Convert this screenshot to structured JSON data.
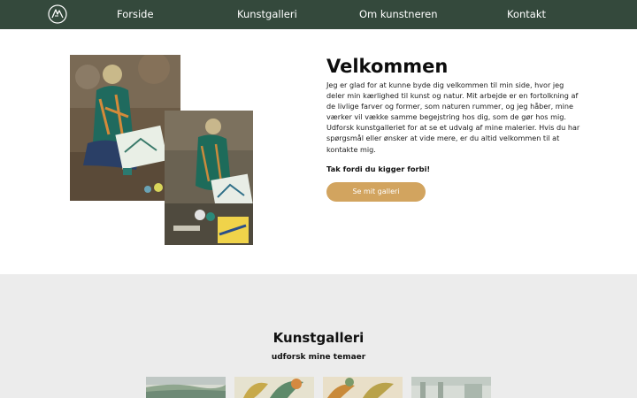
{
  "nav": {
    "items": [
      {
        "label": "Forside"
      },
      {
        "label": "Kunstgalleri"
      },
      {
        "label": "Om kunstneren"
      },
      {
        "label": "Kontakt"
      }
    ],
    "background": "#34493c"
  },
  "hero": {
    "title": "Velkommen",
    "lines": [
      "Jeg er glad for at kunne byde dig velkommen til min side, hvor jeg",
      "deler min kærlighed til kunst og natur. Mit arbejde er en fortolkning af",
      "de livlige farver og former, som naturen rummer, og jeg håber, mine",
      "værker vil vække samme begejstring hos dig, som de gør hos mig.",
      "Udforsk kunstgalleriet for at se et udvalg af mine malerier. Hvis du har",
      "spørgsmål eller ønsker at vide mere, er du altid velkommen til at",
      "kontakte mig."
    ],
    "thanks": "Tak fordi du kigger forbi!",
    "button_label": "Se mit galleri",
    "button_color": "#d2a45f"
  },
  "gallery": {
    "title": "Kunstgalleri",
    "subtitle": "udforsk mine temaer",
    "background": "#ececec"
  }
}
